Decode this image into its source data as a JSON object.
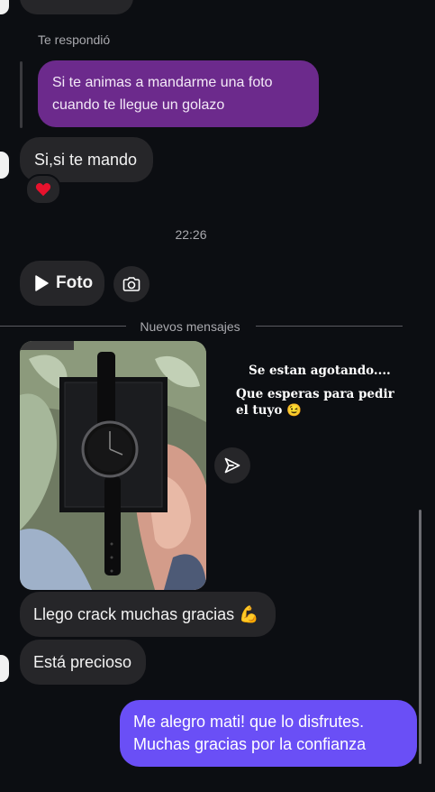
{
  "reply_label": "Te respondió",
  "quoted_message": "Si te animas a mandarme una foto cuando te llegue un golazo",
  "msg_si_te_mando": "Si,si te mando",
  "reaction_icon": "red-heart",
  "timestamp": "22:26",
  "foto_label": "Foto",
  "camera_icon": "camera-icon",
  "new_messages_label": "Nuevos mensajes",
  "story_text": {
    "line1": "Se estan agotando....",
    "line2": "Que esperas para pedir",
    "line3": "el tuyo 😉"
  },
  "msg_llego": "Llego crack muchas gracias 💪",
  "msg_precioso": "Está precioso",
  "msg_sent_line1": "Me alegro mati! que lo disfrutes.",
  "msg_sent_line2": "Muchas gracias por la confianza",
  "colors": {
    "background": "#0c0e12",
    "incoming_bubble": "#262629",
    "quoted_bubble": "#6c2a8c",
    "sent_bubble": "#6a4ff6"
  }
}
